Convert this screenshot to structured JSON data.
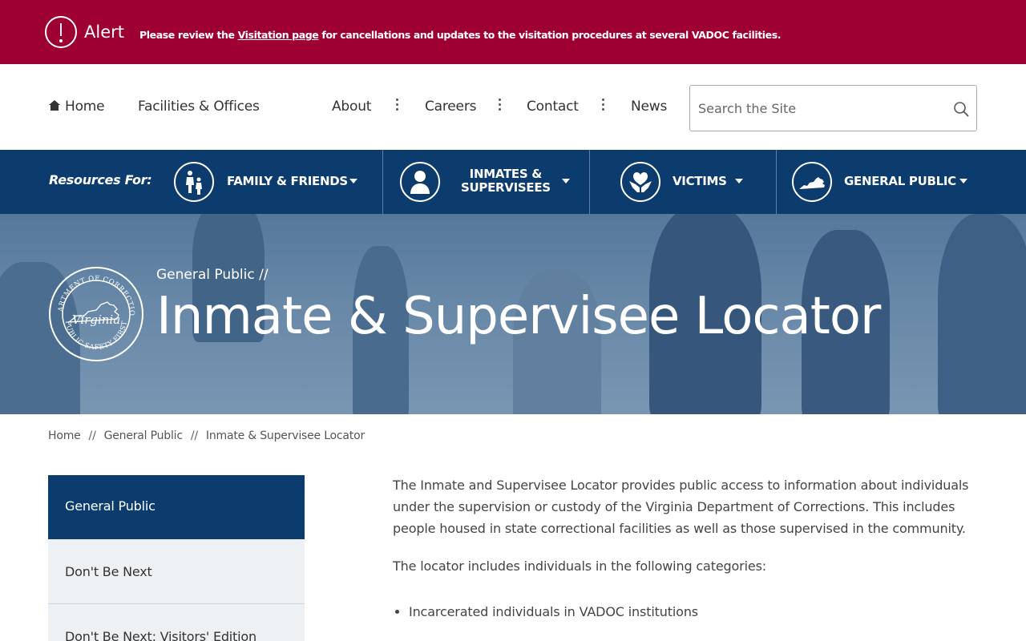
{
  "alert": {
    "title": "Alert",
    "text_before": "Please review the ",
    "link": "Visitation page",
    "text_after": " for cancellations and updates to the visitation procedures at several VADOC facilities."
  },
  "nav": {
    "home": "Home",
    "facilities": "Facilities & Offices",
    "about": "About",
    "careers": "Careers",
    "contact": "Contact",
    "news": "News",
    "search_placeholder": "Search the Site"
  },
  "resources": {
    "label": "Resources For:",
    "items": [
      {
        "label": "FAMILY & FRIENDS",
        "icon": "family-icon"
      },
      {
        "label_line1": "INMATES &",
        "label_line2": "SUPERVISEES",
        "icon": "person-icon"
      },
      {
        "label": "VICTIMS",
        "icon": "heart-hands-icon"
      },
      {
        "label": "GENERAL PUBLIC",
        "icon": "virginia-state-icon"
      }
    ]
  },
  "hero": {
    "parent": "General Public",
    "parent_sep": "//",
    "title": "Inmate & Supervisee Locator",
    "seal": {
      "top_text": "DEPARTMENT OF CORRECTIONS",
      "center_text": "Virginia",
      "bottom_text": "PUBLIC SAFETY FIRST"
    }
  },
  "breadcrumb": {
    "home": "Home",
    "parent": "General Public",
    "current": "Inmate & Supervisee Locator",
    "sep": "//"
  },
  "sidebar": {
    "items": [
      {
        "label": "General Public"
      },
      {
        "label": "Don't Be Next"
      },
      {
        "label": "Don't Be Next: Visitors' Edition"
      }
    ]
  },
  "content": {
    "intro": "The Inmate and Supervisee Locator provides public access to information about individuals under the supervision or custody of the Virginia Department of Corrections. This includes people housed in state correctional facilities as well as those supervised in the community.",
    "categories_intro": "The locator includes individuals in the following categories:",
    "categories": [
      "Incarcerated individuals in VADOC institutions"
    ]
  },
  "colors": {
    "alert_bg": "#9e0033",
    "brand_navy": "#0c3b6e",
    "sidebar_bg": "#eef1f4"
  }
}
